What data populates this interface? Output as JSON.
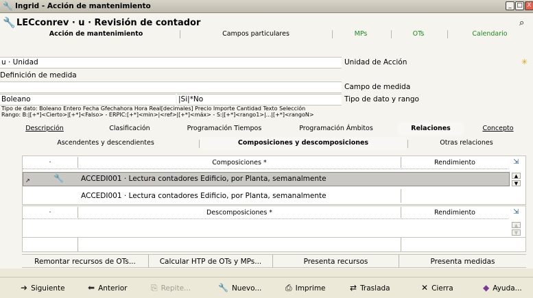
{
  "window": {
    "title": "Ingrid - Acción de mantenimiento",
    "icon": "pipe-icon",
    "controls": [
      "_",
      "□",
      "X"
    ]
  },
  "header": {
    "title": "LECconrev · u · Revisión de contador",
    "icon": "pipe-icon",
    "search_icon": "binoculars-icon"
  },
  "main_tabs": [
    {
      "label": "Acción de mantenimiento",
      "active": true
    },
    {
      "label": "Campos particulares"
    },
    {
      "label": "MPs",
      "color": "#1e8a1e"
    },
    {
      "label": "OTs",
      "color": "#1e8a1e"
    },
    {
      "label": "Calendario",
      "color": "#1e8a1e"
    }
  ],
  "form": {
    "unit_value": "u · Unidad",
    "unit_label": "Unidad de Acción",
    "measure_def_label": "Definición de medida",
    "measure_def_value": "",
    "measure_field_label": "Campo de medida",
    "type_value": "Boleano",
    "range_value": "|Si|*No",
    "type_label": "Tipo de dato y rango",
    "help_line1": "Tipo de dato: Boleano Entero Fecha Gfechahora Hora Real[decimales] Precio Importe Cantidad Texto Selección",
    "help_line2": "Rango: B:|[+*]<Cierto>|[+*]<Falso> - ERPIC:[+*]<min>|<ref>|[+*]<máx> - S:|[+*]<rango1>|...|[+*]<rangoN>"
  },
  "section_tabs": [
    {
      "label": "Descripción"
    },
    {
      "label": "Clasificación"
    },
    {
      "label": "Programación Tiempos"
    },
    {
      "label": "Programación Ámbitos"
    },
    {
      "label": "Relaciones",
      "active": true
    },
    {
      "label": "Concepto"
    }
  ],
  "relation_tabs": [
    {
      "label": "Ascendentes y descendientes"
    },
    {
      "label": "Composiciones y descomposiciones",
      "active": true
    },
    {
      "label": "Otras relaciones"
    }
  ],
  "compositions": {
    "col_dot": "·",
    "col_main": "Composiciones *",
    "col_perf": "Rendimiento",
    "rows": [
      {
        "text": "ACCEDI001 · Lectura contadores Edificio, por Planta, semanalmente",
        "selected": true,
        "icon": "pipe-icon"
      },
      {
        "text": "ACCEDI001 · Lectura contadores Edificio, por Planta, semanalmente"
      }
    ]
  },
  "decompositions": {
    "col_dot": "·",
    "col_main": "Descomposiciones *",
    "col_perf": "Rendimiento",
    "rows": []
  },
  "actions": [
    "Remontar recursos de OTs...",
    "Calcular HTP de OTs y MPs...",
    "Presenta recursos",
    "Presenta medidas"
  ],
  "toolbar": [
    {
      "label": "Siguiente",
      "icon": "arrow-right-icon"
    },
    {
      "label": "Anterior",
      "icon": "arrow-left-icon"
    },
    {
      "label": "Repite...",
      "icon": "repeat-icon",
      "disabled": true
    },
    {
      "label": "Nuevo...",
      "icon": "new-icon"
    },
    {
      "label": "Imprime",
      "icon": "printer-icon"
    },
    {
      "label": "Traslada",
      "icon": "transfer-icon"
    },
    {
      "label": "Cierra",
      "icon": "close-icon"
    },
    {
      "label": "Ayuda...",
      "icon": "help-book-icon"
    }
  ],
  "colors": {
    "green_tab": "#1e8a1e",
    "selected_row": "#c9c8c4",
    "background": "#ece9d8"
  }
}
